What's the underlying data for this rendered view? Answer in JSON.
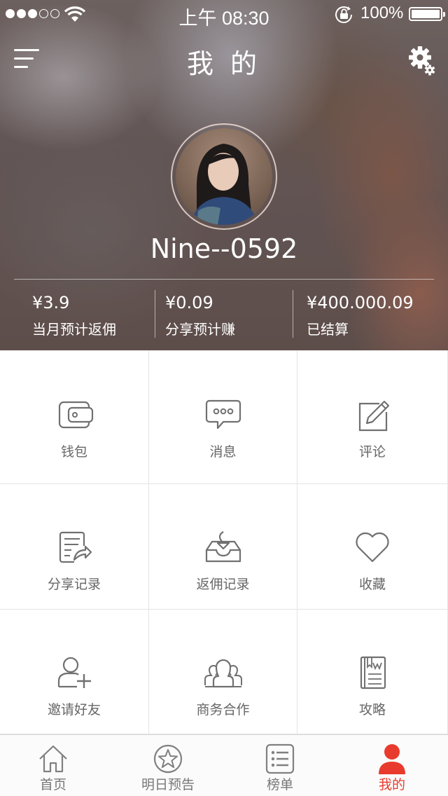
{
  "status_bar": {
    "time": "上午 08:30",
    "battery": "100%"
  },
  "header": {
    "title": "我 的"
  },
  "profile": {
    "username": "Nine--0592"
  },
  "stats": [
    {
      "value": "¥3.9",
      "label": "当月预计返佣"
    },
    {
      "value": "¥0.09",
      "label": "分享预计赚"
    },
    {
      "value": "¥400.000.09",
      "label": "已结算"
    }
  ],
  "grid": [
    {
      "label": "钱包",
      "icon": "wallet-icon"
    },
    {
      "label": "消息",
      "icon": "message-icon"
    },
    {
      "label": "评论",
      "icon": "comment-edit-icon"
    },
    {
      "label": "分享记录",
      "icon": "share-record-icon"
    },
    {
      "label": "返佣记录",
      "icon": "rebate-record-icon"
    },
    {
      "label": "收藏",
      "icon": "heart-icon"
    },
    {
      "label": "邀请好友",
      "icon": "invite-friend-icon"
    },
    {
      "label": "商务合作",
      "icon": "business-cooperation-icon"
    },
    {
      "label": "攻略",
      "icon": "guide-book-icon"
    }
  ],
  "tabbar": [
    {
      "label": "首页",
      "icon": "home-icon",
      "active": false
    },
    {
      "label": "明日预告",
      "icon": "star-icon",
      "active": false
    },
    {
      "label": "榜单",
      "icon": "list-icon",
      "active": false
    },
    {
      "label": "我的",
      "icon": "user-icon",
      "active": true
    }
  ],
  "colors": {
    "accent": "#e83b2e",
    "icon_gray": "#707070",
    "label_gray": "#666666"
  }
}
